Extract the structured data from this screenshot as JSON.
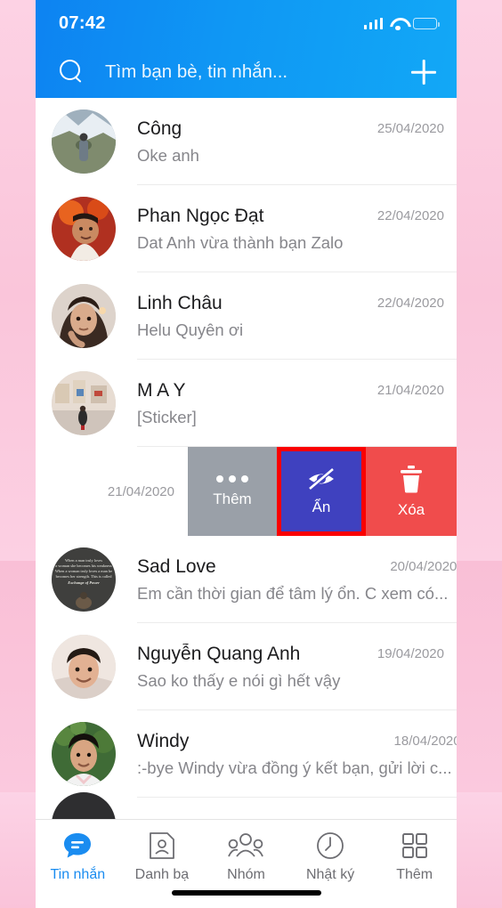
{
  "statusbar": {
    "time": "07:42",
    "signal_icon": "cellular-signal-icon",
    "wifi_icon": "wifi-icon",
    "battery_icon": "battery-low-icon",
    "battery_color": "#ffd426"
  },
  "header": {
    "search_icon": "search-icon",
    "search_placeholder": "Tìm bạn bè, tin nhắn...",
    "add_icon": "plus-icon",
    "gradient_from": "#0d83f2",
    "gradient_to": "#12a8f6"
  },
  "chats": [
    {
      "name": "Công",
      "message": "Oke anh",
      "date": "25/04/2020"
    },
    {
      "name": "Phan Ngọc Đạt",
      "message": "Dat Anh vừa thành bạn Zalo",
      "date": "22/04/2020"
    },
    {
      "name": "Linh Châu",
      "message": "Helu Quyên ơi",
      "date": "22/04/2020"
    },
    {
      "name": "M A Y",
      "message": "[Sticker]",
      "date": "21/04/2020"
    }
  ],
  "swipe_row": {
    "date": "21/04/2020",
    "actions": [
      {
        "label": "Thêm",
        "icon": "ellipsis-icon",
        "color": "#9aa0a8",
        "highlighted": false
      },
      {
        "label": "Ẩn",
        "icon": "eye-slash-icon",
        "color": "#3f41bf",
        "highlighted": true
      },
      {
        "label": "Xóa",
        "icon": "trash-icon",
        "color": "#f04c4c",
        "highlighted": false
      }
    ],
    "highlight_color": "#fb0000"
  },
  "chats_after": [
    {
      "name": "Sad Love",
      "message": "Em cần thời gian để tâm lý ổn. C xem có...",
      "date": "20/04/2020"
    },
    {
      "name": "Nguyễn Quang Anh",
      "message": "Sao ko thấy e nói gì hết vậy",
      "date": "19/04/2020"
    },
    {
      "name": "Windy",
      "message": ":-bye Windy vừa đồng ý kết bạn, gửi lời c...",
      "date": "18/04/2020"
    }
  ],
  "tabbar": {
    "active_color": "#1a8cf0",
    "tabs": [
      {
        "label": "Tin nhắn",
        "icon": "chat-bubble-icon",
        "active": true
      },
      {
        "label": "Danh bạ",
        "icon": "contact-card-icon",
        "active": false
      },
      {
        "label": "Nhóm",
        "icon": "group-people-icon",
        "active": false
      },
      {
        "label": "Nhật ký",
        "icon": "clock-icon",
        "active": false
      },
      {
        "label": "Thêm",
        "icon": "grid-icon",
        "active": false
      }
    ]
  }
}
